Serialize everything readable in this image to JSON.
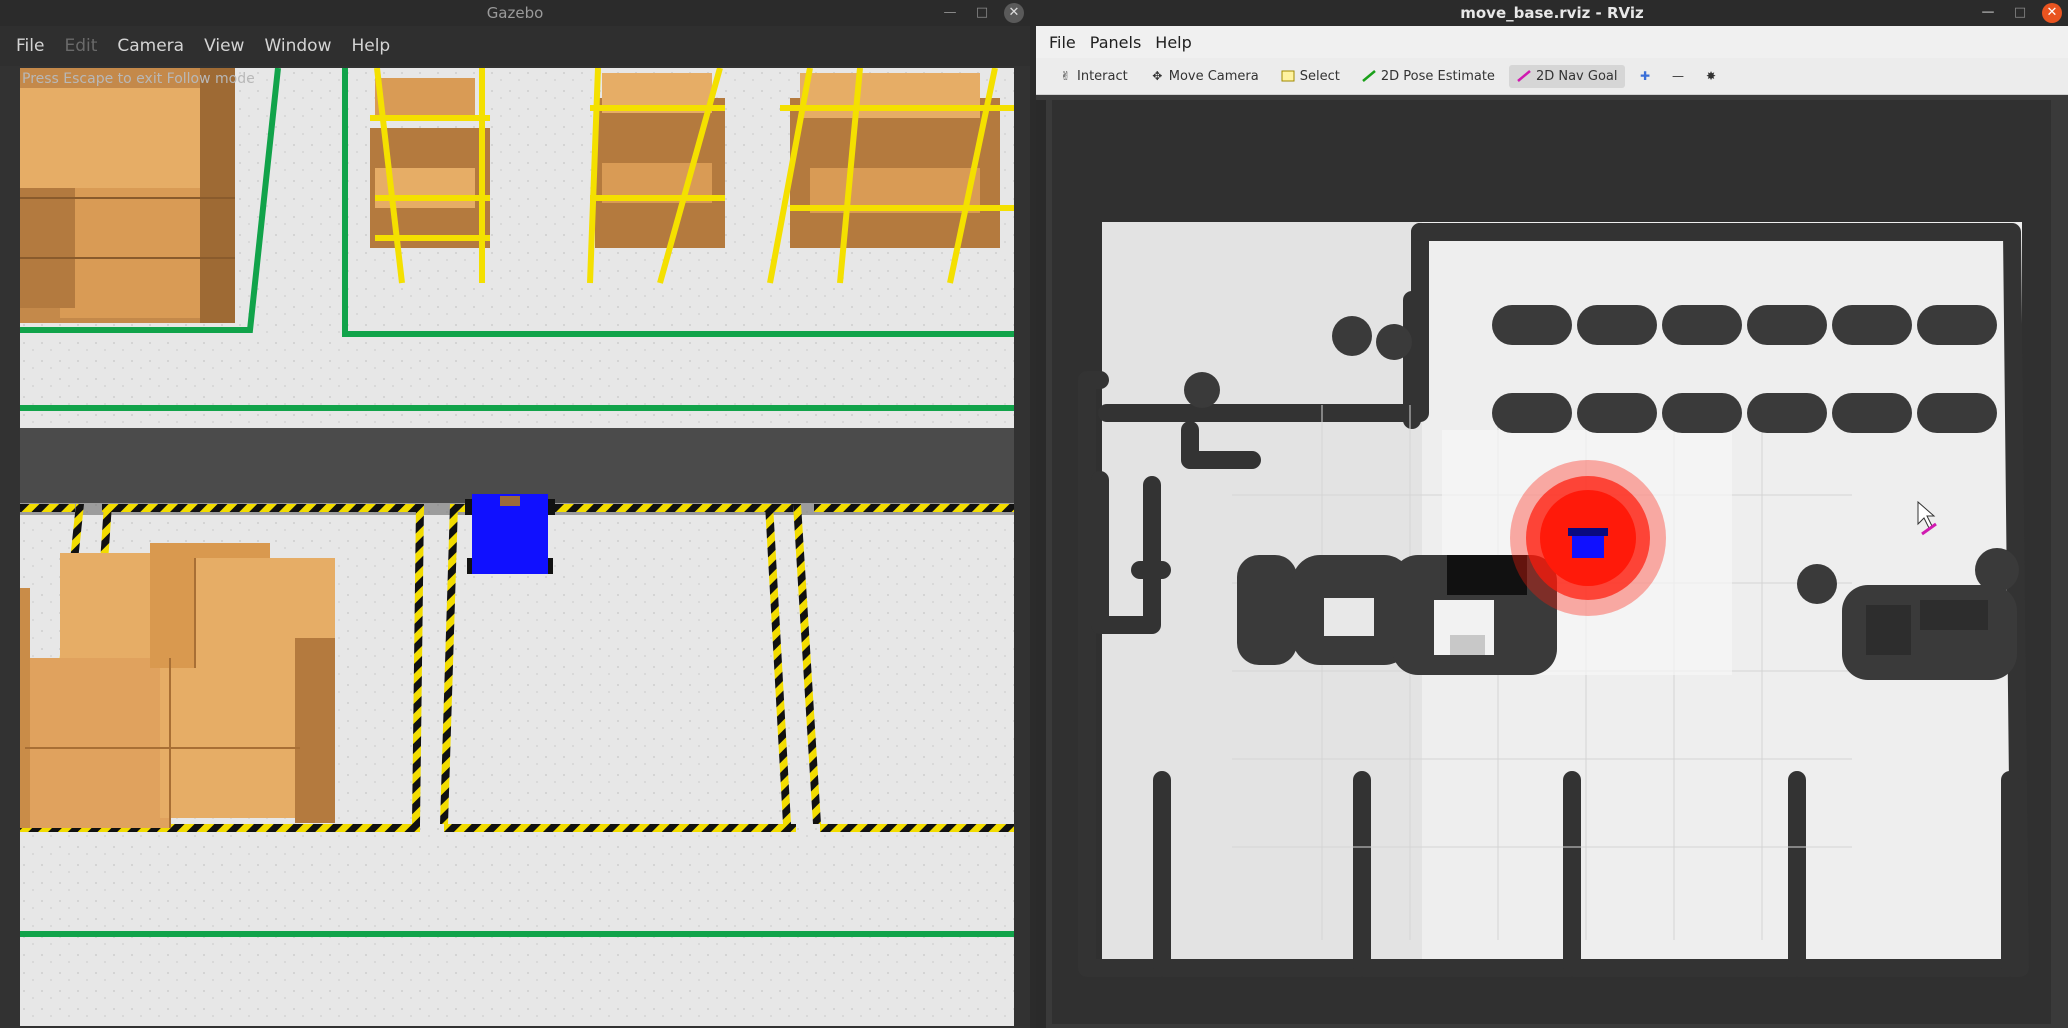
{
  "gazebo": {
    "title": "Gazebo",
    "menu": [
      "File",
      "Edit",
      "Camera",
      "View",
      "Window",
      "Help"
    ],
    "menu_disabled": [
      "Edit"
    ],
    "hint": "Press Escape to exit Follow mode"
  },
  "rviz": {
    "title": "move_base.rviz - RViz",
    "menu": [
      "File",
      "Panels",
      "Help"
    ],
    "tools": [
      {
        "label": "Interact",
        "icon": "hand-icon"
      },
      {
        "label": "Move Camera",
        "icon": "camera-move-icon"
      },
      {
        "label": "Select",
        "icon": "select-box-icon"
      },
      {
        "label": "2D Pose Estimate",
        "icon": "green-arrow-icon"
      },
      {
        "label": "2D Nav Goal",
        "icon": "pink-arrow-icon",
        "active": true
      },
      {
        "label": "",
        "icon": "crosshair-plus-icon"
      },
      {
        "label": "",
        "icon": "minus-icon"
      },
      {
        "label": "",
        "icon": "target-icon"
      }
    ]
  },
  "colors": {
    "floor": "#e6e6e6",
    "aisle": "#4b4b4b",
    "shelf_yellow": "#f4e000",
    "box": "#e6ad66",
    "robot": "#1010ff",
    "line_green": "#11a34a",
    "map_free": "#eeeeee",
    "map_wall": "#333333",
    "particles": "#ff1a0a",
    "accent": "#e95420"
  }
}
